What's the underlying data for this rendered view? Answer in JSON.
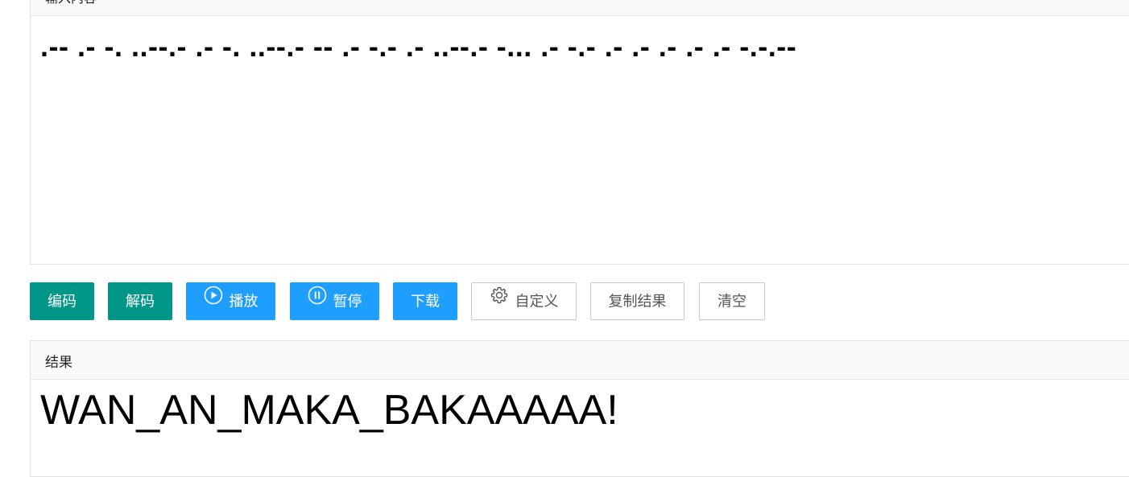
{
  "input": {
    "header_label": "输入内容",
    "value": ".-- .- -. ..--.- .- -. ..--.- -- .- -.- .- ..--.- -... .- -.- .- .- .- .- .- -.-.--"
  },
  "toolbar": {
    "encode_label": "编码",
    "decode_label": "解码",
    "play_label": "播放",
    "pause_label": "暂停",
    "download_label": "下载",
    "custom_label": "自定义",
    "copy_label": "复制结果",
    "clear_label": "清空"
  },
  "result": {
    "header_label": "结果",
    "value": "WAN_AN_MAKA_BAKAAAAA!"
  },
  "colors": {
    "green": "#009688",
    "blue": "#1e9fff",
    "border": "#c9c9c9"
  },
  "icons": {
    "play": "play-circle-icon",
    "pause": "pause-circle-icon",
    "custom": "gear-icon"
  }
}
